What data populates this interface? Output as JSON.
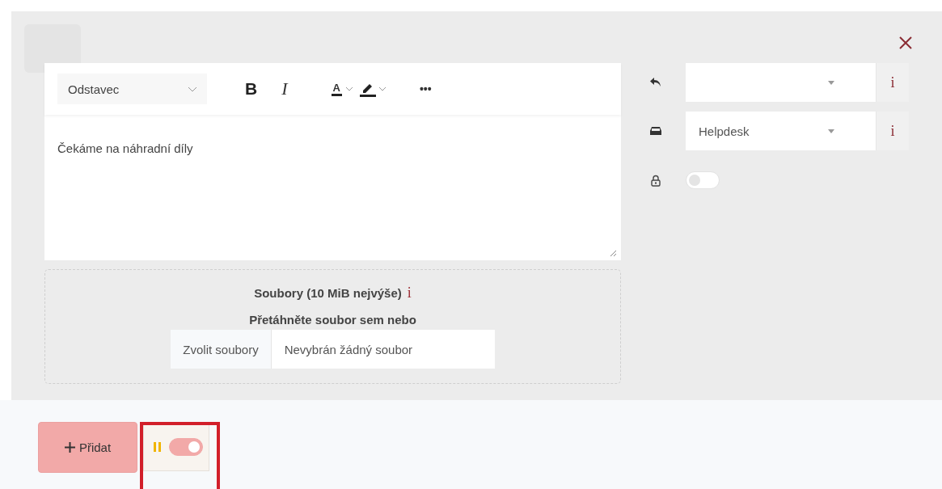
{
  "editor": {
    "block_format": "Odstavec",
    "toolbar": [
      {
        "kind": "bold",
        "label": "B"
      },
      {
        "kind": "italic",
        "label": "I"
      },
      {
        "kind": "font_color",
        "label": "A"
      },
      {
        "kind": "highlight"
      },
      {
        "kind": "more",
        "label": "•••"
      }
    ],
    "content": "Čekáme na náhradní díly"
  },
  "attachments": {
    "title": "Soubory (10 MiB nejvýše)",
    "info": "i",
    "hint": "Přetáhněte soubor sem nebo",
    "choose_button": "Zvolit soubory",
    "file_status": "Nevybrán žádný soubor"
  },
  "side_fields": [
    {
      "kind": "select",
      "info": "i"
    },
    {
      "kind": "select",
      "value": "Helpdesk",
      "info": "i"
    },
    {
      "kind": "toggle",
      "on": false
    }
  ],
  "footer": {
    "add_button": "Přidat",
    "pause_toggle": {
      "on": true
    }
  }
}
